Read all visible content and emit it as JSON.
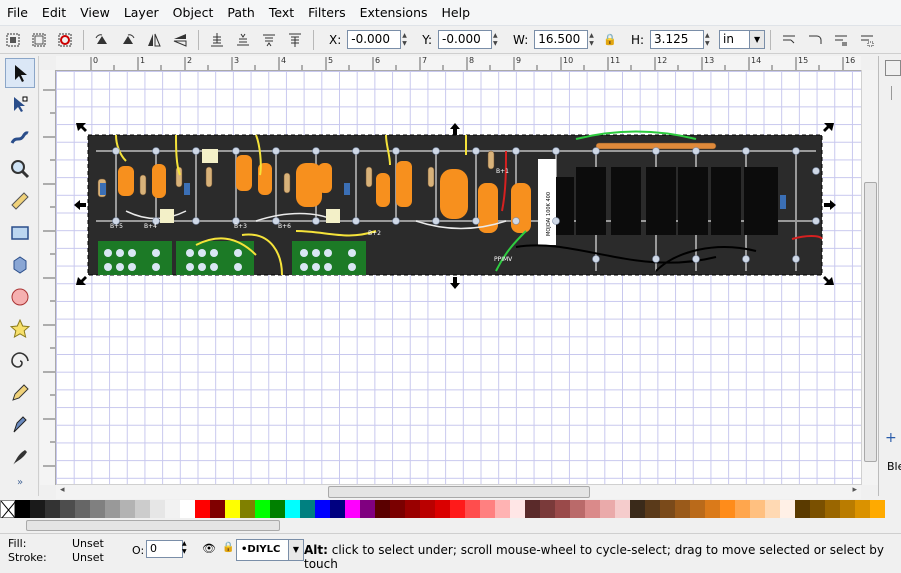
{
  "menu": {
    "file": "File",
    "edit": "Edit",
    "view": "View",
    "layer": "Layer",
    "object": "Object",
    "path": "Path",
    "text": "Text",
    "filters": "Filters",
    "extensions": "Extensions",
    "help": "Help"
  },
  "toolbar": {
    "x_label": "X:",
    "x_value": "-0.000",
    "y_label": "Y:",
    "y_value": "-0.000",
    "w_label": "W:",
    "w_value": "16.500",
    "h_label": "H:",
    "h_value": "3.125",
    "unit": "in"
  },
  "ruler": {
    "top_labels": [
      "0",
      "1",
      "2",
      "3",
      "4",
      "5",
      "6",
      "7",
      "8",
      "9",
      "10",
      "11",
      "12",
      "13",
      "14",
      "15",
      "16",
      "17"
    ]
  },
  "canvas": {
    "board_labels": {
      "label_a": "B+5",
      "label_b": "B+4",
      "label_c": "B+3",
      "label_d": "B+6",
      "label_e": "B+2",
      "label_f": "B+1",
      "label_g": "PPIMV",
      "label_h": "MOJOAI 100K 400"
    }
  },
  "palette": {
    "colors": [
      "#000000",
      "#1a1a1a",
      "#333333",
      "#4d4d4d",
      "#666666",
      "#808080",
      "#999999",
      "#b3b3b3",
      "#cccccc",
      "#e6e6e6",
      "#f2f2f2",
      "#ffffff",
      "#ff0000",
      "#800000",
      "#ffff00",
      "#808000",
      "#00ff00",
      "#008000",
      "#00ffff",
      "#008080",
      "#0000ff",
      "#000080",
      "#ff00ff",
      "#800080",
      "#5a0000",
      "#7a0000",
      "#9a0000",
      "#ba0000",
      "#da0000",
      "#ff1a1a",
      "#ff4d4d",
      "#ff8080",
      "#ffb3b3",
      "#ffe6e6",
      "#5a2a2a",
      "#7a3a3a",
      "#9a4a4a",
      "#ba6a6a",
      "#da8a8a",
      "#eaaaaa",
      "#f5cccc",
      "#3a2a1a",
      "#5a3a1a",
      "#7a4a1a",
      "#9a5a1a",
      "#ba6a1a",
      "#da7a1a",
      "#ff8c1a",
      "#ffa64d",
      "#ffc080",
      "#ffd9b3",
      "#fff0e6",
      "#5a3a00",
      "#7a5000",
      "#9a6600",
      "#ba7c00",
      "#da9200",
      "#ffaa00"
    ]
  },
  "status": {
    "fill_label": "Fill:",
    "fill_value": "Unset",
    "stroke_label": "Stroke:",
    "stroke_value": "Unset",
    "opacity_label": "O:",
    "opacity_value": "0",
    "layer_name": "•DIYLC",
    "message_bold": "Alt:",
    "message": " click to select under; scroll mouse-wheel to cycle-select; drag to move selected or select by touch"
  },
  "dock": {
    "partial_label": "Ble"
  }
}
